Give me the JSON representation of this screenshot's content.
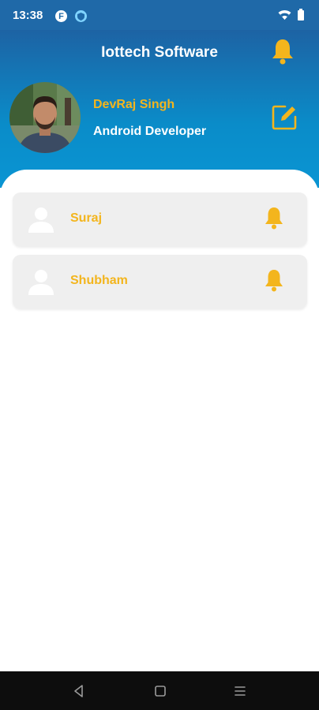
{
  "status_bar": {
    "time": "13:38",
    "app_icon_letter": "F",
    "icons": [
      "notification-app-icon",
      "vpn-shield-icon",
      "wifi-icon",
      "battery-icon"
    ]
  },
  "header": {
    "title": "Iottech Software",
    "bell_icon": "bell-icon"
  },
  "profile": {
    "name": "DevRaj Singh",
    "role": "Android Developer",
    "avatar_icon": "profile-photo",
    "edit_icon": "edit-icon"
  },
  "contacts": [
    {
      "name": "Suraj",
      "icon": "person-icon",
      "action_icon": "bell-icon"
    },
    {
      "name": "Shubham",
      "icon": "person-icon",
      "action_icon": "bell-icon"
    }
  ],
  "nav_bar": {
    "buttons": [
      "back-icon",
      "home-icon",
      "recents-icon"
    ]
  },
  "colors": {
    "status_bar": "#1f69a8",
    "header_top": "#1d63a4",
    "header_bottom": "#0a95d3",
    "accent_yellow": "#f3b51d",
    "card_background": "#efefef",
    "nav_bar": "#0d0d0d"
  }
}
